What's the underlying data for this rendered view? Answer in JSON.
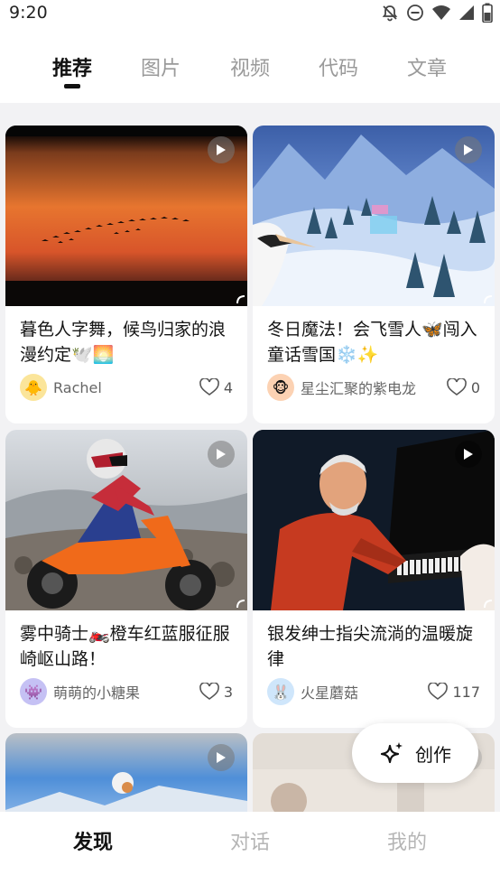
{
  "status": {
    "time": "9:20"
  },
  "tabs": [
    {
      "label": "推荐",
      "active": true
    },
    {
      "label": "图片",
      "active": false
    },
    {
      "label": "视频",
      "active": false
    },
    {
      "label": "代码",
      "active": false
    },
    {
      "label": "文章",
      "active": false
    }
  ],
  "cards": [
    {
      "title": "暮色人字舞，候鸟归家的浪漫约定🕊️🌅",
      "author": "Rachel",
      "likes": "4",
      "avatar": "🐥"
    },
    {
      "title": "冬日魔法！会飞雪人🦋闯入童话雪国❄️✨",
      "author": "星尘汇聚的紫电龙",
      "likes": "0",
      "avatar": "🐵"
    },
    {
      "title": "雾中骑士🏍️橙车红蓝服征服崎岖山路！",
      "author": "萌萌的小糖果",
      "likes": "3",
      "avatar": "👾"
    },
    {
      "title": "银发绅士指尖流淌的温暖旋律",
      "author": "火星蘑菇",
      "likes": "117",
      "avatar": "🐰"
    }
  ],
  "fab": {
    "label": "创作"
  },
  "bottom_nav": [
    {
      "label": "发现",
      "active": true
    },
    {
      "label": "对话",
      "active": false
    },
    {
      "label": "我的",
      "active": false
    }
  ],
  "colors": {
    "accent": "#111111",
    "inactive": "#9a9a9a",
    "background": "#f2f2f4"
  }
}
